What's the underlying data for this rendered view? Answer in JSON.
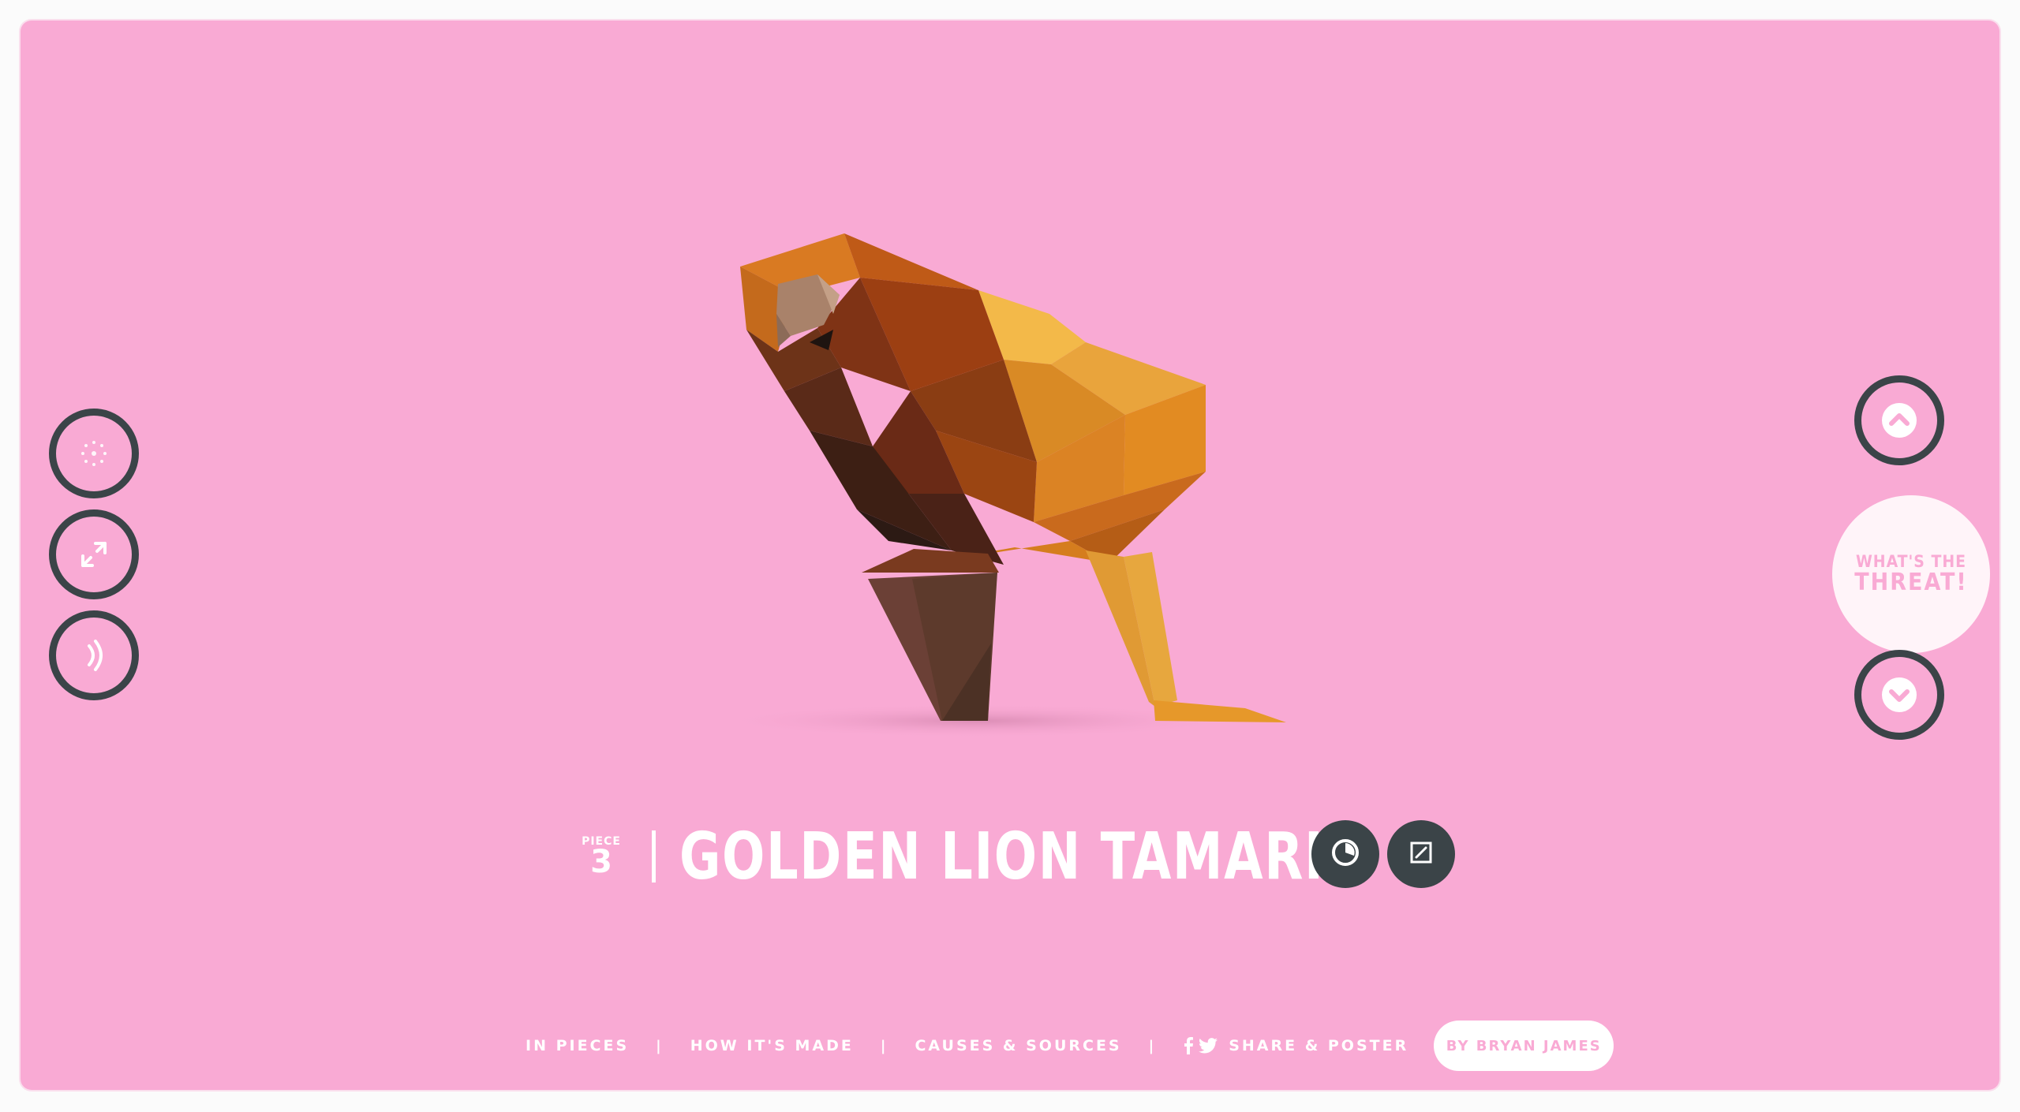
{
  "piece": {
    "label": "PIECE",
    "number": "3"
  },
  "species": {
    "name": "GOLDEN LION TAMARIN"
  },
  "side_controls": {
    "left": [
      "dots-icon",
      "arrows-icon",
      "sound-icon"
    ],
    "right_up": "chevron-up-icon",
    "right_down": "chevron-down-icon"
  },
  "threat": {
    "line1": "WHAT'S THE",
    "line2": "THREAT!"
  },
  "footer": {
    "links": [
      "IN PIECES",
      "HOW IT'S MADE",
      "CAUSES & SOURCES"
    ],
    "separator": "|",
    "share_label": "SHARE & POSTER",
    "credit_label": "BY BRYAN JAMES"
  },
  "colors": {
    "background": "#f9aad4",
    "dark": "#3b4448",
    "white": "#ffffff"
  }
}
